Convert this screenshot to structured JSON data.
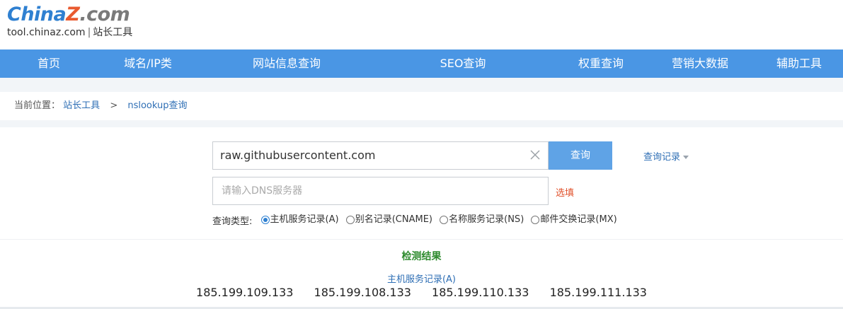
{
  "logo": {
    "part1": "China",
    "part2": "Z",
    "part3": ".com",
    "site": "tool.chinaz.com",
    "separator": "|",
    "subtitle": "站长工具"
  },
  "nav": {
    "items": [
      {
        "label": "首页"
      },
      {
        "label": "域名/IP类"
      },
      {
        "label": "网站信息查询"
      },
      {
        "label": "SEO查询"
      },
      {
        "label": "权重查询"
      },
      {
        "label": "营销大数据"
      },
      {
        "label": "辅助工具"
      }
    ]
  },
  "breadcrumb": {
    "label": "当前位置：",
    "home": "站长工具",
    "separator": ">",
    "current": "nslookup查询"
  },
  "search": {
    "value": "raw.githubusercontent.com",
    "button": "查询",
    "history": "查询记录",
    "dns_placeholder": "请输入DNS服务器",
    "optional": "选填"
  },
  "query_types": {
    "label": "查询类型:",
    "options": [
      {
        "label": "主机服务记录(A)",
        "checked": true
      },
      {
        "label": "别名记录(CNAME)",
        "checked": false
      },
      {
        "label": "名称服务记录(NS)",
        "checked": false
      },
      {
        "label": "邮件交换记录(MX)",
        "checked": false
      }
    ]
  },
  "result": {
    "title": "检测结果",
    "subtitle": "主机服务记录(A)",
    "ips": [
      "185.199.109.133",
      "185.199.108.133",
      "185.199.110.133",
      "185.199.111.133"
    ]
  },
  "colors": {
    "nav_bg": "#4a96e4",
    "button_bg": "#5fa3e6",
    "link": "#2f6fb5",
    "result_title": "#2e8b2e",
    "optional": "#e0502a"
  }
}
